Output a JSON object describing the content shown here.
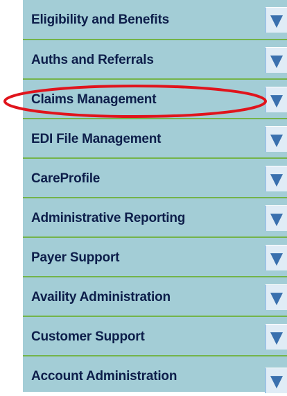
{
  "menu": {
    "items": [
      {
        "label": "Eligibility and Benefits"
      },
      {
        "label": "Auths and Referrals"
      },
      {
        "label": "Claims Management"
      },
      {
        "label": "EDI File Management"
      },
      {
        "label": "CareProfile"
      },
      {
        "label": "Administrative Reporting"
      },
      {
        "label": "Payer Support"
      },
      {
        "label": "Availity Administration"
      },
      {
        "label": "Customer Support"
      },
      {
        "label": "Account Administration"
      }
    ],
    "highlighted_item": "Claims Management"
  },
  "colors": {
    "menu_background": "#a3cdd6",
    "divider": "#74b44a",
    "label_text": "#0d1e4a",
    "dropdown_button": "#e0ecf6",
    "dropdown_arrow": "#3a70ae",
    "highlight_ellipse": "#e0141c"
  },
  "icons": {
    "dropdown": "chevron-down-icon"
  }
}
